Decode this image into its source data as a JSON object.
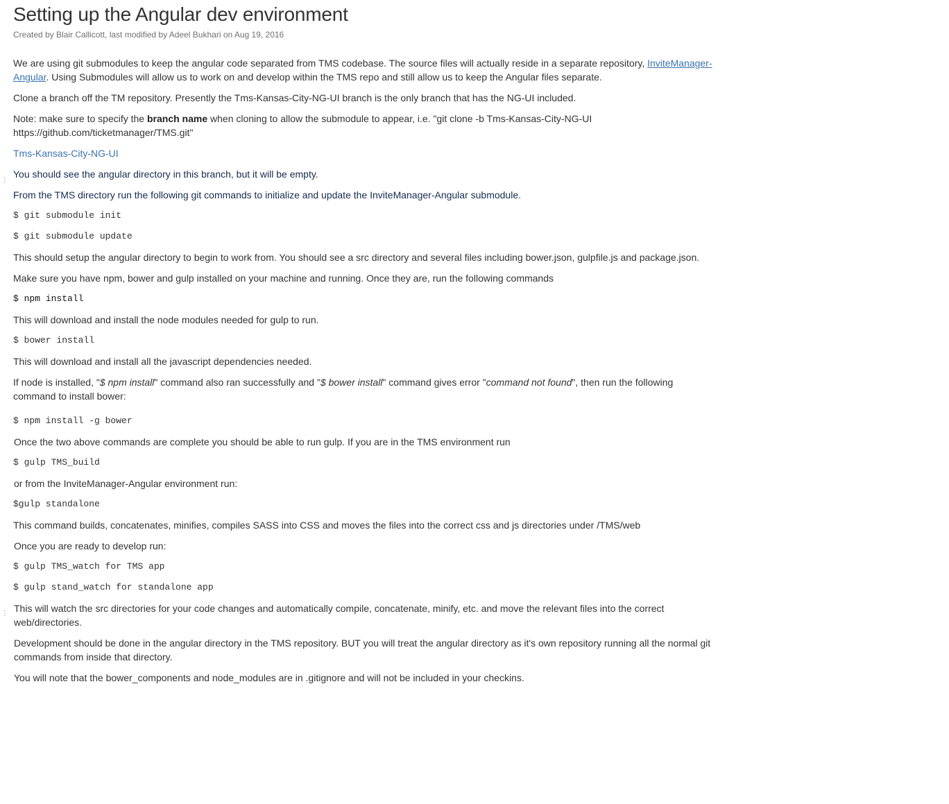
{
  "page": {
    "title": "Setting up the Angular dev environment",
    "meta": "Created by Blair Callicott, last modified by Adeel Bukhari on Aug 19, 2016"
  },
  "content": {
    "p1_text_a": "We are using git submodules to keep the angular code separated from TMS codebase. The source files will actually reside in a separate repository, ",
    "p1_link": "InviteManager-Angular",
    "p1_text_b": ". Using Submodules will allow us to work on and develop within the TMS repo and still allow us to keep the Angular files separate.",
    "p2": "Clone a branch off the TM repository. Presently the Tms-Kansas-City-NG-UI branch is the only branch that has the NG-UI included.",
    "p3_a": "Note: make sure to specify the ",
    "p3_bold": "branch name",
    "p3_b": " when cloning to allow the submodule to appear, i.e. \"git clone -b Tms-Kansas-City-NG-UI https://github.com/ticketmanager/TMS.git\"",
    "branch_link": "Tms-Kansas-City-NG-UI",
    "p4": "You should see the angular directory in this branch, but it will be empty.",
    "p5": "From the TMS directory run the following git commands to initialize and update the InviteManager-Angular submodule.",
    "cmd1": "$ git submodule init",
    "cmd2": "$ git submodule update",
    "p6": "This should setup the angular directory to begin to work from. You should see a src directory and several files including bower.json, gulpfile.js and package.json.",
    "p7": "Make sure you have npm, bower and gulp installed on your machine and running. Once they are, run the following commands",
    "cmd3": "$ npm install",
    "p8": "This will download and install the node modules needed for gulp to run.",
    "cmd4": "$ bower install",
    "p9": "This will download and install all the javascript dependencies needed.",
    "p10_a": "If node is installed, \"",
    "p10_em1": "$ npm install",
    "p10_b": "\" command also ran successfully and \"",
    "p10_em2": "$ bower install",
    "p10_c": "\" command gives error \"",
    "p10_em3": "command not found",
    "p10_d": "\", then run the following command to install bower:",
    "cmd5": "$ npm install -g bower",
    "p11": "Once the two above commands are complete you should be able to run gulp. If you are in the TMS environment run",
    "cmd6": "$ gulp TMS_build",
    "p12": "or from the InviteManager-Angular environment run:",
    "cmd7": "$gulp standalone",
    "p13": "This command builds, concatenates, minifies, compiles SASS into CSS and moves the files into the correct css and js directories under /TMS/web",
    "p14": "Once you are ready to develop run:",
    "cmd8": "$ gulp TMS_watch for TMS app",
    "cmd9": "$ gulp stand_watch for standalone app",
    "p15": "This will watch the src directories for your code changes and automatically compile, concatenate, minify, etc. and move the relevant files into the correct web/directories.",
    "p16": "Development should be done in the angular directory in the TMS repository. BUT you will treat the angular directory as it's own repository running all the normal git commands from inside that directory.",
    "p17": "You will note that the bower_components and node_modules are in .gitignore and will not be included in your checkins."
  }
}
